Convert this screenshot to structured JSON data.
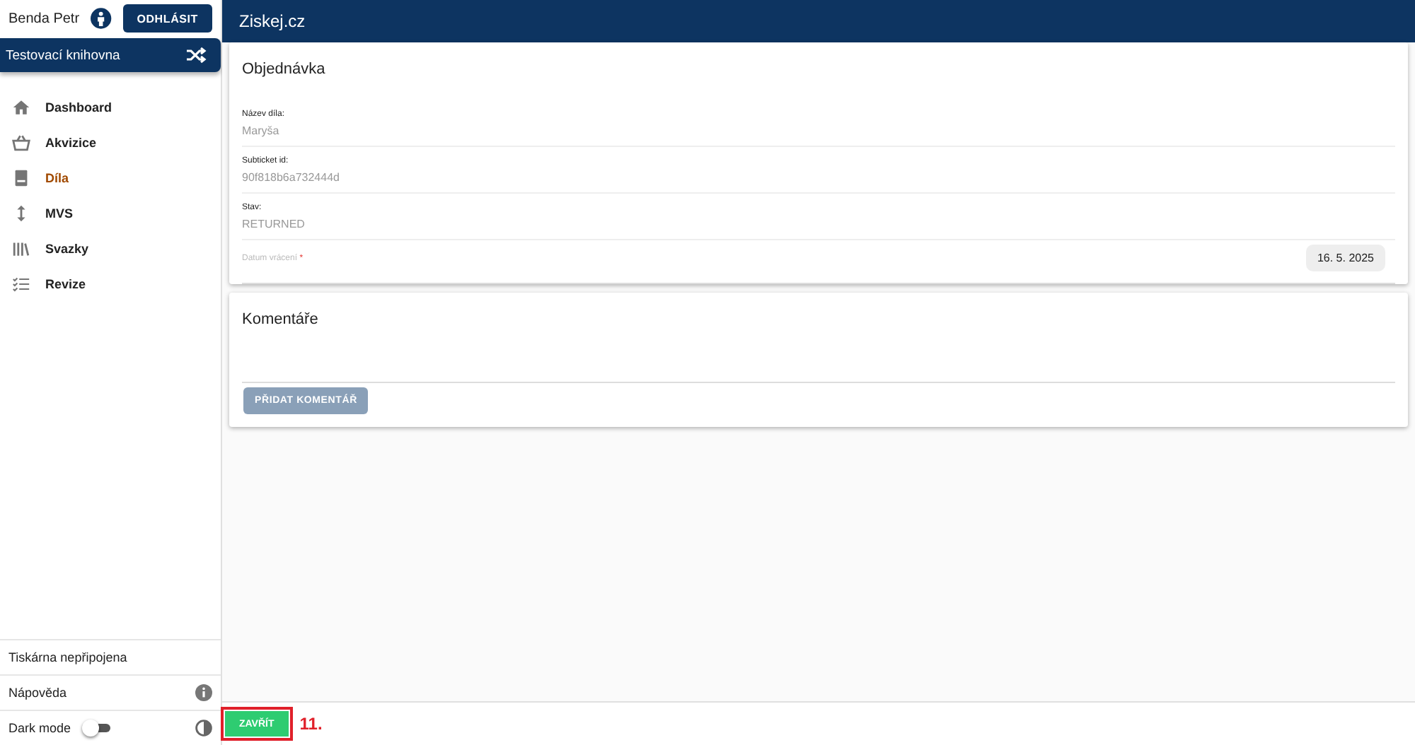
{
  "user": {
    "name": "Benda Petr",
    "logout": "ODHLÁSIT"
  },
  "library": {
    "name": "Testovací knihovna"
  },
  "nav": [
    {
      "label": "Dashboard",
      "selected": false
    },
    {
      "label": "Akvizice",
      "selected": false
    },
    {
      "label": "Díla",
      "selected": true
    },
    {
      "label": "MVS",
      "selected": false
    },
    {
      "label": "Svazky",
      "selected": false
    },
    {
      "label": "Revize",
      "selected": false
    }
  ],
  "sidebar_bottom": {
    "printer": "Tiskárna nepřipojena",
    "help": "Nápověda",
    "dark_mode": {
      "label": "Dark mode",
      "on": false
    }
  },
  "header": {
    "title": "Ziskej.cz"
  },
  "order": {
    "title": "Objednávka",
    "fields": [
      {
        "label": "Název díla:",
        "value": "Maryša"
      },
      {
        "label": "Subticket id:",
        "value": "90f818b6a732444d"
      },
      {
        "label": "Stav:",
        "value": "RETURNED"
      }
    ],
    "date": {
      "label": "Datum vrácení",
      "required_mark": "*",
      "value": "16. 5. 2025"
    }
  },
  "comments": {
    "title": "Komentáře",
    "add_button": "PŘIDAT KOMENTÁŘ"
  },
  "footer": {
    "close_button": "ZAVŘÍT",
    "annotation": "11."
  }
}
